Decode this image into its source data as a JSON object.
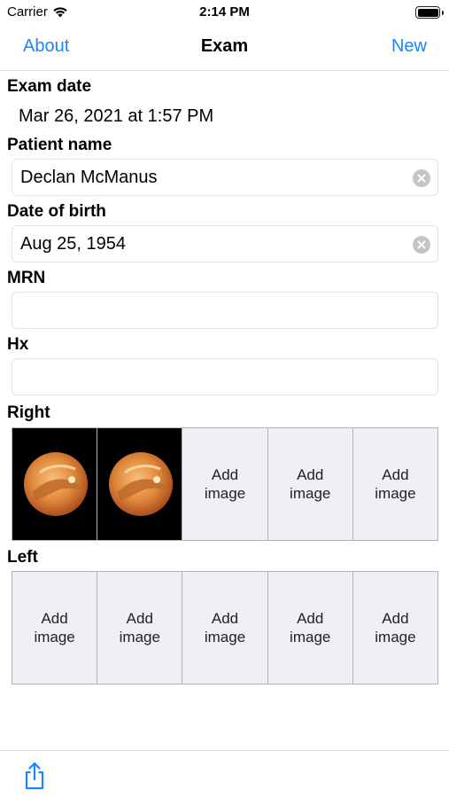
{
  "status_bar": {
    "carrier": "Carrier",
    "time": "2:14 PM"
  },
  "nav": {
    "left": "About",
    "title": "Exam",
    "right": "New"
  },
  "exam_date": {
    "label": "Exam date",
    "value": "Mar 26, 2021 at 1:57 PM"
  },
  "patient_name": {
    "label": "Patient name",
    "value": "Declan McManus"
  },
  "dob": {
    "label": "Date of birth",
    "value": "Aug 25, 1954"
  },
  "mrn": {
    "label": "MRN",
    "value": ""
  },
  "hx": {
    "label": "Hx",
    "value": ""
  },
  "right_eye": {
    "label": "Right",
    "add_label": "Add\nimage"
  },
  "left_eye": {
    "label": "Left",
    "add_label": "Add\nimage"
  },
  "colors": {
    "accent": "#1a84ff",
    "slot_bg": "#efeff4"
  }
}
